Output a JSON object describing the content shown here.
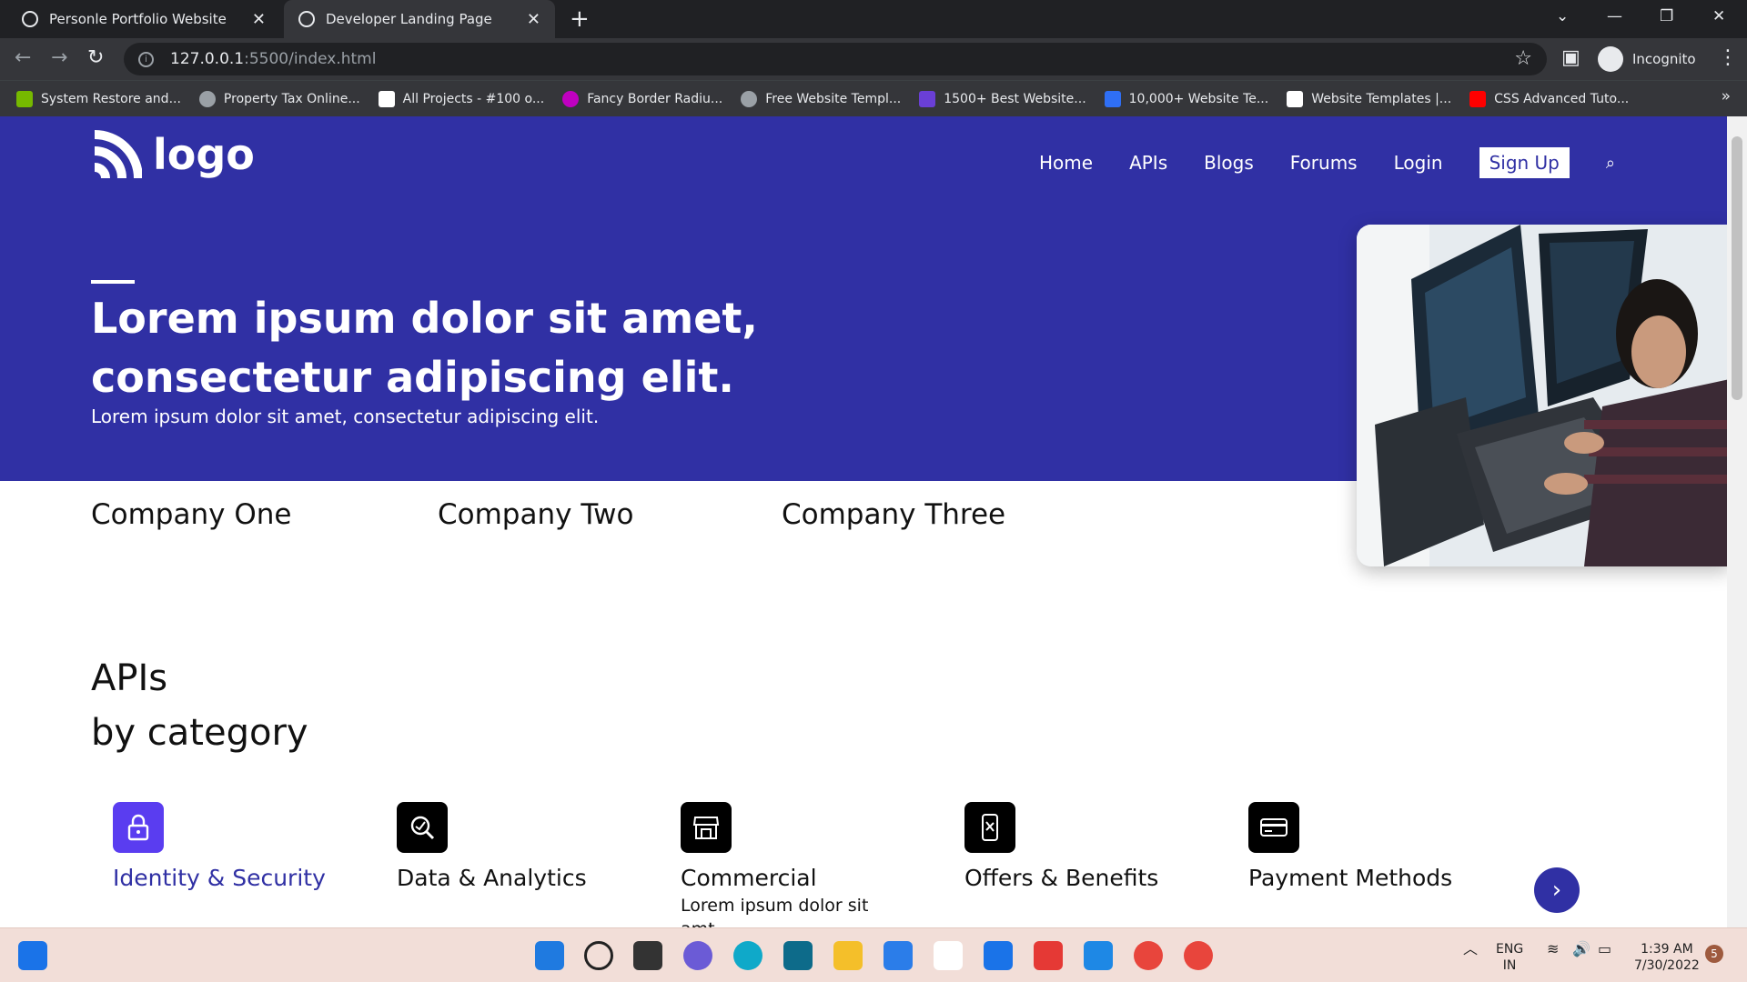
{
  "browser": {
    "tabs": [
      {
        "title": "Personle Portfolio Website"
      },
      {
        "title": "Developer Landing Page"
      }
    ],
    "url_host": "127.0.0.1",
    "url_path": ":5500/index.html",
    "profile_label": "Incognito",
    "bookmarks": [
      {
        "label": "System Restore and...",
        "color": "#76b900"
      },
      {
        "label": "Property Tax Online...",
        "color": "#9aa0a6"
      },
      {
        "label": "All Projects - #100 o...",
        "color": "#ffffff"
      },
      {
        "label": "Fancy Border Radiu...",
        "color": "#c000c0"
      },
      {
        "label": "Free Website Templ...",
        "color": "#9aa0a6"
      },
      {
        "label": "1500+ Best Website...",
        "color": "#6a3fd6"
      },
      {
        "label": "10,000+ Website Te...",
        "color": "#2f6ff5"
      },
      {
        "label": "Website Templates |...",
        "color": "#ffffff"
      },
      {
        "label": "CSS Advanced Tuto...",
        "color": "#ff0000"
      }
    ]
  },
  "site": {
    "logo_text": "logo",
    "nav": [
      "Home",
      "APIs",
      "Blogs",
      "Forums",
      "Login"
    ],
    "signup_label": "Sign Up",
    "hero_title": "Lorem ipsum dolor sit amet, consectetur adipiscing elit.",
    "hero_subtitle": "Lorem ipsum dolor sit amet, consectetur adipiscing elit.",
    "companies": [
      "Company One",
      "Company Two",
      "Company Three"
    ],
    "apis_title_line1": "APIs",
    "apis_title_line2": "by category",
    "categories": [
      {
        "label": "Identity & Security",
        "icon": "lock-icon",
        "active": true
      },
      {
        "label": "Data & Analytics",
        "icon": "analytics-icon",
        "active": false
      },
      {
        "label": "Commercial",
        "icon": "store-icon",
        "active": false,
        "desc": "Lorem ipsum dolor sit amt,"
      },
      {
        "label": "Offers & Benefits",
        "icon": "offer-icon",
        "active": false
      },
      {
        "label": "Payment Methods",
        "icon": "card-icon",
        "active": false
      }
    ],
    "accent": "#3030a4"
  },
  "taskbar": {
    "lang_line1": "ENG",
    "lang_line2": "IN",
    "time": "1:39 AM",
    "date": "7/30/2022",
    "notif_count": "5"
  }
}
